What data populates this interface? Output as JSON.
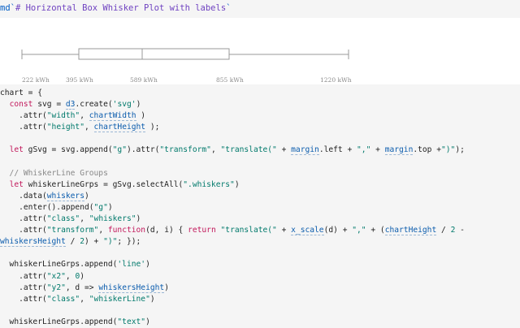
{
  "markdown_cell": {
    "prefix": "md`",
    "content": "# Horizontal Box Whisker Plot with labels",
    "suffix": "`"
  },
  "plot": {
    "tick_labels": [
      "222 kWh",
      "395 kWh",
      "589 kWh",
      "855 kWh",
      "1220 kWh"
    ],
    "stroke_color": "#999999",
    "box_fill": "#ffffff"
  },
  "code_lines": [
    [
      [
        "def",
        "chart = {"
      ]
    ],
    [
      [
        "def",
        "  "
      ],
      [
        "kw",
        "const"
      ],
      [
        "def",
        " svg = "
      ],
      [
        "ref",
        "d3"
      ],
      [
        "def",
        ".create("
      ],
      [
        "str",
        "'svg'"
      ],
      [
        "def",
        ")"
      ]
    ],
    [
      [
        "def",
        "    .attr("
      ],
      [
        "str",
        "\"width\""
      ],
      [
        "def",
        ", "
      ],
      [
        "ref",
        "chartWidth"
      ],
      [
        "def",
        " )"
      ]
    ],
    [
      [
        "def",
        "    .attr("
      ],
      [
        "str",
        "\"height\""
      ],
      [
        "def",
        ", "
      ],
      [
        "ref",
        "chartHeight"
      ],
      [
        "def",
        " );"
      ]
    ],
    [
      [
        "def",
        ""
      ]
    ],
    [
      [
        "def",
        "  "
      ],
      [
        "kw",
        "let"
      ],
      [
        "def",
        " gSvg = svg.append("
      ],
      [
        "str",
        "\"g\""
      ],
      [
        "def",
        ").attr("
      ],
      [
        "str",
        "\"transform\""
      ],
      [
        "def",
        ", "
      ],
      [
        "str",
        "\"translate(\""
      ],
      [
        "def",
        " + "
      ],
      [
        "ref",
        "margin"
      ],
      [
        "def",
        ".left + "
      ],
      [
        "str",
        "\",\""
      ],
      [
        "def",
        " + "
      ],
      [
        "ref",
        "margin"
      ],
      [
        "def",
        ".top +"
      ],
      [
        "str",
        "\")\""
      ],
      [
        "def",
        ");"
      ]
    ],
    [
      [
        "def",
        ""
      ]
    ],
    [
      [
        "com",
        "  // WhiskerLine Groups"
      ]
    ],
    [
      [
        "def",
        "  "
      ],
      [
        "kw",
        "let"
      ],
      [
        "def",
        " whiskerLineGrps = gSvg.selectAll("
      ],
      [
        "str",
        "\".whiskers\""
      ],
      [
        "def",
        ")"
      ]
    ],
    [
      [
        "def",
        "    .data("
      ],
      [
        "ref",
        "whiskers"
      ],
      [
        "def",
        ")"
      ]
    ],
    [
      [
        "def",
        "    .enter().append("
      ],
      [
        "str",
        "\"g\""
      ],
      [
        "def",
        ")"
      ]
    ],
    [
      [
        "def",
        "    .attr("
      ],
      [
        "str",
        "\"class\""
      ],
      [
        "def",
        ", "
      ],
      [
        "str",
        "\"whiskers\""
      ],
      [
        "def",
        ")"
      ]
    ],
    [
      [
        "def",
        "    .attr("
      ],
      [
        "str",
        "\"transform\""
      ],
      [
        "def",
        ", "
      ],
      [
        "kw",
        "function"
      ],
      [
        "def",
        "(d, i) { "
      ],
      [
        "kw",
        "return"
      ],
      [
        "def",
        " "
      ],
      [
        "str",
        "\"translate(\""
      ],
      [
        "def",
        " + "
      ],
      [
        "ref",
        "x_scale"
      ],
      [
        "def",
        "(d) + "
      ],
      [
        "str",
        "\",\""
      ],
      [
        "def",
        " + ("
      ],
      [
        "ref",
        "chartHeight"
      ],
      [
        "def",
        " / "
      ],
      [
        "num",
        "2"
      ],
      [
        "def",
        " -"
      ]
    ],
    [
      [
        "ref",
        "whiskersHeight"
      ],
      [
        "def",
        " / "
      ],
      [
        "num",
        "2"
      ],
      [
        "def",
        ") + "
      ],
      [
        "str",
        "\")\""
      ],
      [
        "def",
        "; });"
      ]
    ],
    [
      [
        "def",
        ""
      ]
    ],
    [
      [
        "def",
        "  whiskerLineGrps.append("
      ],
      [
        "str",
        "'line'"
      ],
      [
        "def",
        ")"
      ]
    ],
    [
      [
        "def",
        "    .attr("
      ],
      [
        "str",
        "\"x2\""
      ],
      [
        "def",
        ", "
      ],
      [
        "num",
        "0"
      ],
      [
        "def",
        ")"
      ]
    ],
    [
      [
        "def",
        "    .attr("
      ],
      [
        "str",
        "\"y2\""
      ],
      [
        "def",
        ", d => "
      ],
      [
        "ref",
        "whiskersHeight"
      ],
      [
        "def",
        ")"
      ]
    ],
    [
      [
        "def",
        "    .attr("
      ],
      [
        "str",
        "\"class\""
      ],
      [
        "def",
        ", "
      ],
      [
        "str",
        "\"whiskerLine\""
      ],
      [
        "def",
        ")"
      ]
    ],
    [
      [
        "def",
        ""
      ]
    ],
    [
      [
        "def",
        "  whiskerLineGrps.append("
      ],
      [
        "str",
        "\"text\""
      ],
      [
        "def",
        ")"
      ]
    ]
  ]
}
